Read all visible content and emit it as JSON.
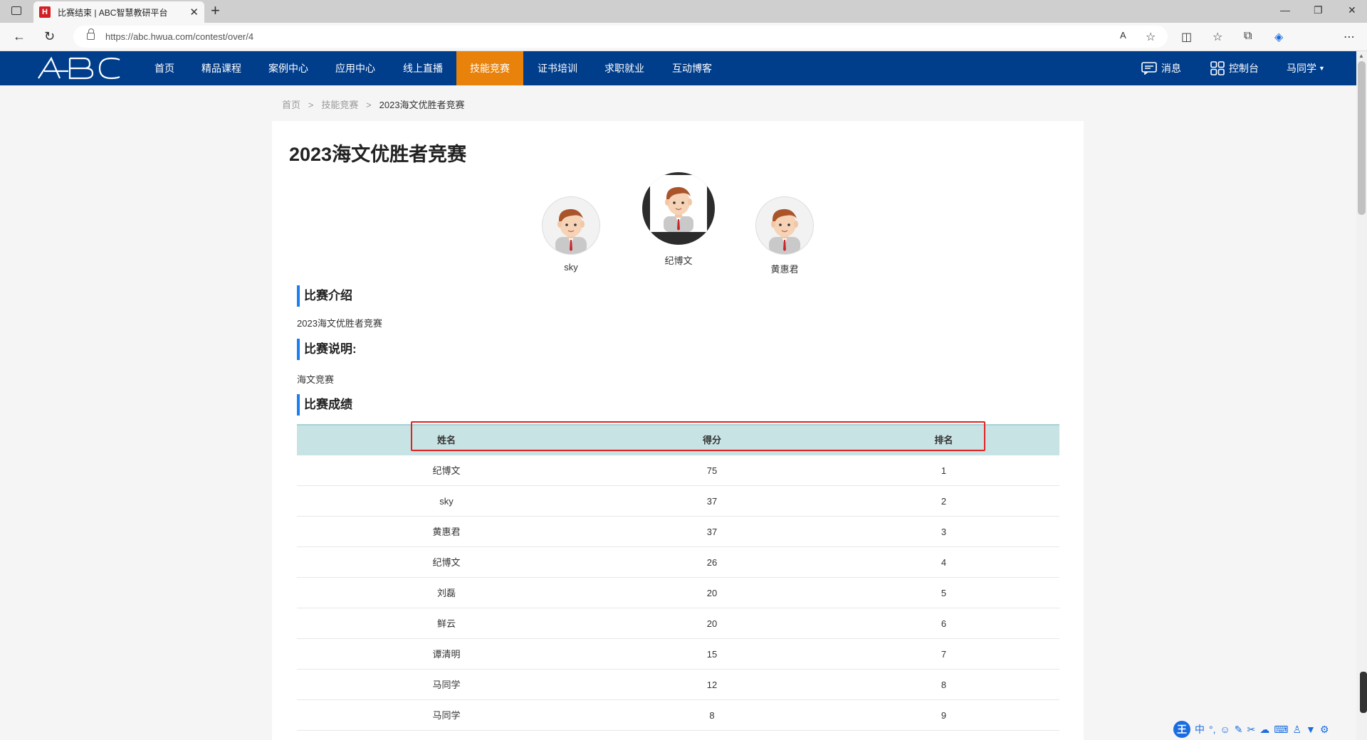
{
  "browser": {
    "tab_title": "比赛结束 | ABC智慧教研平台",
    "favicon_letter": "H",
    "url": "https://abc.hwua.com/contest/over/4"
  },
  "nav": {
    "logo": "ABC",
    "items": [
      "首页",
      "精品课程",
      "案例中心",
      "应用中心",
      "线上直播",
      "技能竞赛",
      "证书培训",
      "求职就业",
      "互动博客"
    ],
    "active_index": 5,
    "messages": "消息",
    "console": "控制台",
    "user": "马同学"
  },
  "breadcrumb": {
    "home": "首页",
    "parent": "技能竞赛",
    "current": "2023海文优胜者竞赛"
  },
  "page": {
    "title": "2023海文优胜者竞赛"
  },
  "podium": {
    "first": "纪博文",
    "second": "sky",
    "third": "黄惠君"
  },
  "sections": {
    "intro_heading": "比赛介绍",
    "intro_text": "2023海文优胜者竞赛",
    "desc_heading": "比赛说明:",
    "desc_text": "海文竞赛",
    "results_heading": "比赛成绩"
  },
  "table": {
    "headers": [
      "姓名",
      "得分",
      "排名"
    ],
    "rows": [
      [
        "纪博文",
        "75",
        "1"
      ],
      [
        "sky",
        "37",
        "2"
      ],
      [
        "黄惠君",
        "37",
        "3"
      ],
      [
        "纪博文",
        "26",
        "4"
      ],
      [
        "刘磊",
        "20",
        "5"
      ],
      [
        "鲜云",
        "20",
        "6"
      ],
      [
        "谭清明",
        "15",
        "7"
      ],
      [
        "马同学",
        "12",
        "8"
      ],
      [
        "马同学",
        "8",
        "9"
      ]
    ]
  },
  "colors": {
    "nav_bg": "#003e8c",
    "nav_active": "#e8820b",
    "section_accent": "#1a7ef0",
    "table_header": "#c8e3e4",
    "highlight": "#e32121"
  },
  "ime": {
    "logo": "王",
    "lang": "中"
  }
}
